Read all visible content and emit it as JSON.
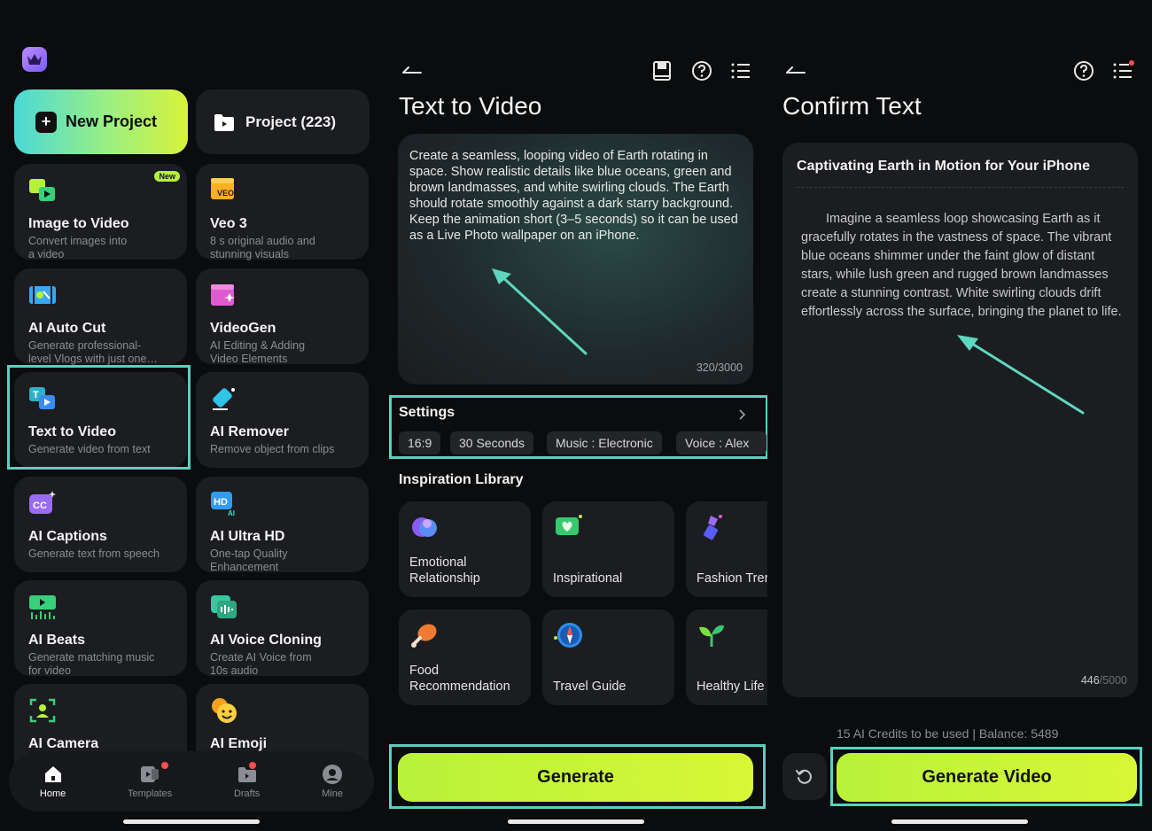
{
  "home": {
    "new_project": "New Project",
    "project": "Project (223)",
    "new_badge": "New",
    "tools": [
      {
        "title": "Image to Video",
        "sub1": "Convert images into",
        "sub2": "a video",
        "icon": "image-to-video-icon"
      },
      {
        "title": "Veo 3",
        "sub1": "8 s original audio and",
        "sub2": "stunning visuals",
        "icon": "veo3-icon"
      },
      {
        "title": "AI Auto Cut",
        "sub1": "Generate professional-",
        "sub2": "level Vlogs with just one…",
        "icon": "auto-cut-icon"
      },
      {
        "title": "VideoGen",
        "sub1": "AI Editing & Adding",
        "sub2": "Video Elements",
        "icon": "videogen-icon"
      },
      {
        "title": "Text to Video",
        "sub1": "Generate video from text",
        "sub2": "",
        "icon": "text-to-video-icon"
      },
      {
        "title": "AI Remover",
        "sub1": "Remove object from clips",
        "sub2": "",
        "icon": "eraser-icon"
      },
      {
        "title": "AI Captions",
        "sub1": "Generate text from speech",
        "sub2": "",
        "icon": "captions-icon"
      },
      {
        "title": "AI Ultra HD",
        "sub1": "One-tap Quality",
        "sub2": "Enhancement",
        "icon": "hd-icon"
      },
      {
        "title": "AI Beats",
        "sub1": "Generate matching music",
        "sub2": "for video",
        "icon": "beats-icon"
      },
      {
        "title": "AI Voice Cloning",
        "sub1": "Create AI Voice from",
        "sub2": "10s audio",
        "icon": "voice-clone-icon"
      },
      {
        "title": "AI Camera",
        "sub1": "",
        "sub2": "",
        "icon": "camera-icon"
      },
      {
        "title": "AI Emoji",
        "sub1": "",
        "sub2": "",
        "icon": "emoji-icon"
      }
    ],
    "tabs": [
      {
        "label": "Home"
      },
      {
        "label": "Templates"
      },
      {
        "label": "Drafts"
      },
      {
        "label": "Mine"
      }
    ]
  },
  "t2v": {
    "title": "Text to Video",
    "prompt": "Create a seamless, looping video of Earth rotating in space. Show realistic details like blue oceans, green and brown landmasses, and white swirling clouds. The Earth should rotate smoothly against a dark starry background. Keep the animation short (3–5 seconds) so it can be used as a Live Photo wallpaper on an iPhone.",
    "counter": "320/3000",
    "settings_label": "Settings",
    "chips": [
      "16:9",
      "30 Seconds",
      "Music : Electronic",
      "Voice : Alex"
    ],
    "library_title": "Inspiration Library",
    "library": [
      {
        "line1": "Emotional",
        "line2": "Relationship"
      },
      {
        "line1": "Inspirational",
        "line2": ""
      },
      {
        "line1": "Fashion Trer",
        "line2": ""
      },
      {
        "line1": "Food",
        "line2": "Recommendation"
      },
      {
        "line1": "Travel Guide",
        "line2": ""
      },
      {
        "line1": "Healthy Life",
        "line2": ""
      }
    ],
    "generate": "Generate"
  },
  "confirm": {
    "title": "Confirm Text",
    "heading": "Captivating Earth in Motion for Your iPhone",
    "body": "Imagine a seamless loop showcasing Earth as it gracefully rotates in the vastness of space. The vibrant blue oceans shimmer under the faint glow of distant stars, while lush green and rugged brown landmasses create a stunning contrast. White swirling clouds drift effortlessly across the surface, bringing the planet to life.",
    "counter_used": "446",
    "counter_total": "/5000",
    "credits": "15 AI Credits to be used",
    "sep": "|",
    "balance": "Balance: 5489",
    "generate_video": "Generate Video"
  },
  "colors": {
    "accent": "#b8f23a",
    "highlight": "#58d1c0",
    "arrow": "#5fd6bf"
  }
}
